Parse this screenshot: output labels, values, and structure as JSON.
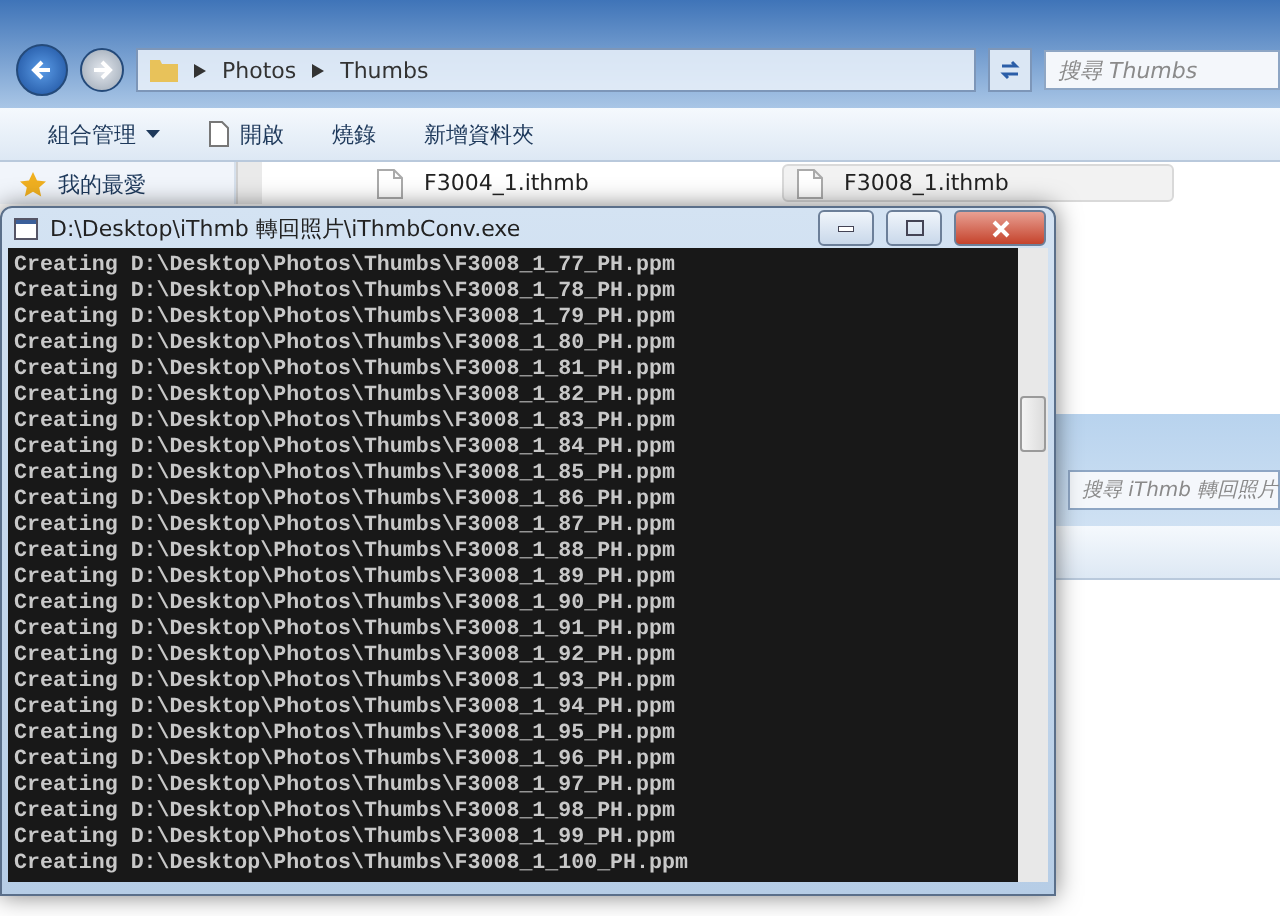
{
  "explorer": {
    "breadcrumb": [
      "Photos",
      "Thumbs"
    ],
    "search": {
      "placeholder": "搜尋 Thumbs"
    },
    "toolbar": [
      {
        "label": "組合管理",
        "kind": "menu"
      },
      {
        "label": "開啟",
        "kind": "open"
      },
      {
        "label": "燒錄",
        "kind": "plain"
      },
      {
        "label": "新增資料夾",
        "kind": "plain"
      }
    ],
    "sidebar": {
      "items": [
        {
          "label": "我的最愛"
        }
      ]
    },
    "files": [
      {
        "name": "F3004_1.ithmb",
        "selected": false
      },
      {
        "name": "F3008_1.ithmb",
        "selected": true
      }
    ]
  },
  "explorer_2": {
    "search": {
      "placeholder": "搜尋 iThmb 轉回照片"
    }
  },
  "console": {
    "title": "D:\\Desktop\\iThmb 轉回照片\\iThmbConv.exe",
    "lines": [
      "Creating D:\\Desktop\\Photos\\Thumbs\\F3008_1_77_PH.ppm",
      "Creating D:\\Desktop\\Photos\\Thumbs\\F3008_1_78_PH.ppm",
      "Creating D:\\Desktop\\Photos\\Thumbs\\F3008_1_79_PH.ppm",
      "Creating D:\\Desktop\\Photos\\Thumbs\\F3008_1_80_PH.ppm",
      "Creating D:\\Desktop\\Photos\\Thumbs\\F3008_1_81_PH.ppm",
      "Creating D:\\Desktop\\Photos\\Thumbs\\F3008_1_82_PH.ppm",
      "Creating D:\\Desktop\\Photos\\Thumbs\\F3008_1_83_PH.ppm",
      "Creating D:\\Desktop\\Photos\\Thumbs\\F3008_1_84_PH.ppm",
      "Creating D:\\Desktop\\Photos\\Thumbs\\F3008_1_85_PH.ppm",
      "Creating D:\\Desktop\\Photos\\Thumbs\\F3008_1_86_PH.ppm",
      "Creating D:\\Desktop\\Photos\\Thumbs\\F3008_1_87_PH.ppm",
      "Creating D:\\Desktop\\Photos\\Thumbs\\F3008_1_88_PH.ppm",
      "Creating D:\\Desktop\\Photos\\Thumbs\\F3008_1_89_PH.ppm",
      "Creating D:\\Desktop\\Photos\\Thumbs\\F3008_1_90_PH.ppm",
      "Creating D:\\Desktop\\Photos\\Thumbs\\F3008_1_91_PH.ppm",
      "Creating D:\\Desktop\\Photos\\Thumbs\\F3008_1_92_PH.ppm",
      "Creating D:\\Desktop\\Photos\\Thumbs\\F3008_1_93_PH.ppm",
      "Creating D:\\Desktop\\Photos\\Thumbs\\F3008_1_94_PH.ppm",
      "Creating D:\\Desktop\\Photos\\Thumbs\\F3008_1_95_PH.ppm",
      "Creating D:\\Desktop\\Photos\\Thumbs\\F3008_1_96_PH.ppm",
      "Creating D:\\Desktop\\Photos\\Thumbs\\F3008_1_97_PH.ppm",
      "Creating D:\\Desktop\\Photos\\Thumbs\\F3008_1_98_PH.ppm",
      "Creating D:\\Desktop\\Photos\\Thumbs\\F3008_1_99_PH.ppm",
      "Creating D:\\Desktop\\Photos\\Thumbs\\F3008_1_100_PH.ppm"
    ]
  }
}
